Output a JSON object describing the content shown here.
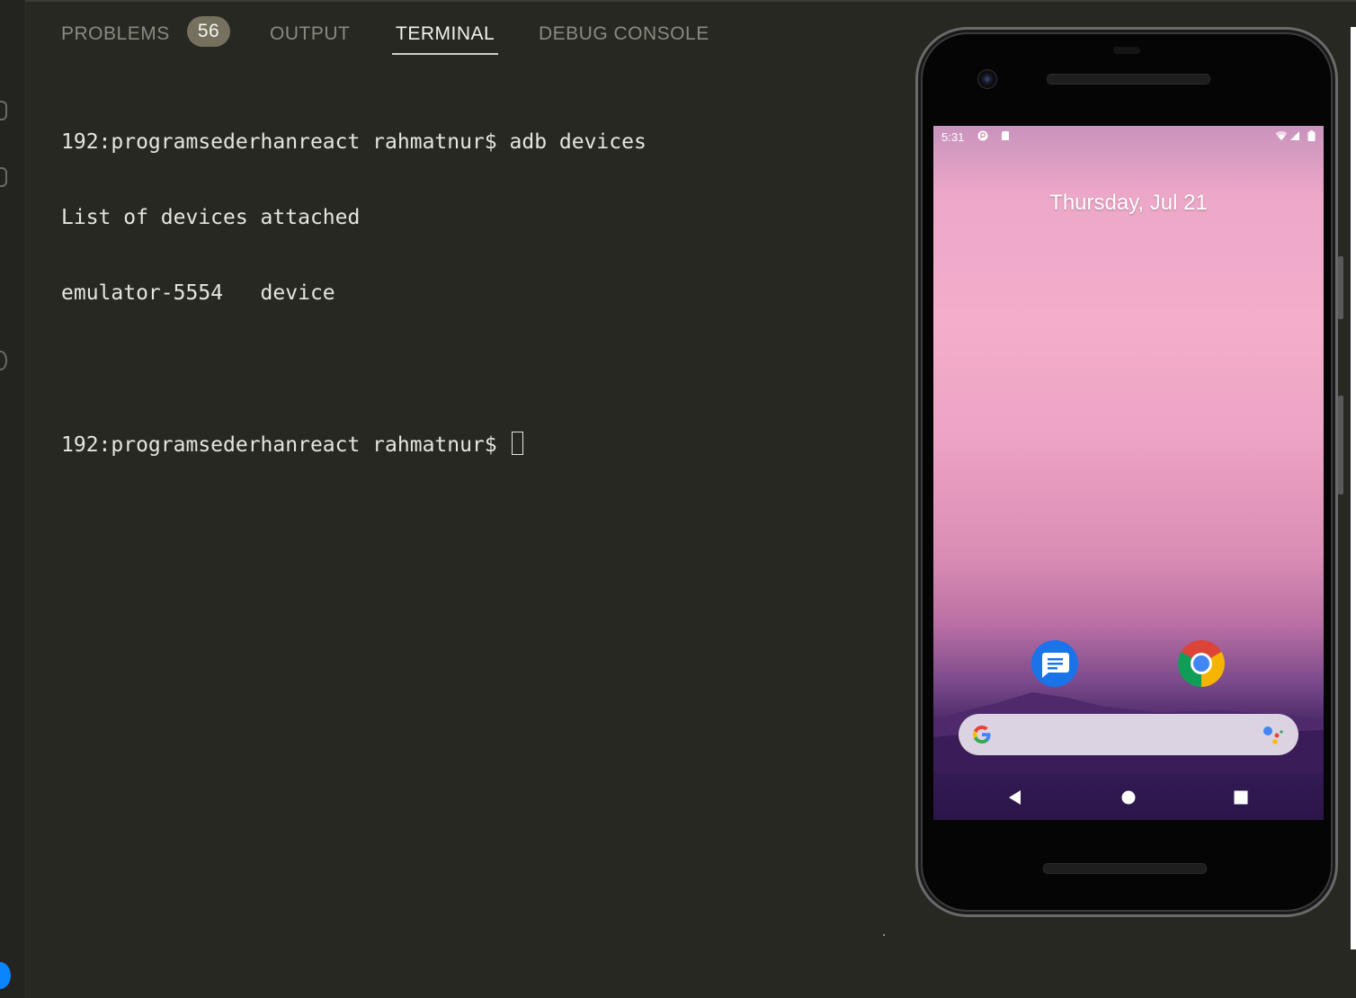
{
  "panel": {
    "tabs": [
      {
        "label": "PROBLEMS",
        "badge": "56"
      },
      {
        "label": "OUTPUT"
      },
      {
        "label": "TERMINAL",
        "active": true
      },
      {
        "label": "DEBUG CONSOLE"
      }
    ]
  },
  "terminal": {
    "lines": [
      "192:programsederhanreact rahmatnur$ adb devices",
      "List of devices attached",
      "emulator-5554   device",
      "",
      "192:programsederhanreact rahmatnur$ "
    ]
  },
  "phone": {
    "status_time": "5:31",
    "date": "Thursday, Jul 21",
    "apps": [
      "messages-icon",
      "chrome-icon"
    ],
    "search_logo": "google-g-icon",
    "assistant_icon": "google-assistant-icon",
    "nav": [
      "back-icon",
      "home-icon",
      "recents-icon"
    ]
  },
  "colors": {
    "editor_bg": "#272822",
    "tab_inactive": "#8b8a7e",
    "tab_active": "#f2f2ec",
    "badge_bg": "#75715e"
  }
}
